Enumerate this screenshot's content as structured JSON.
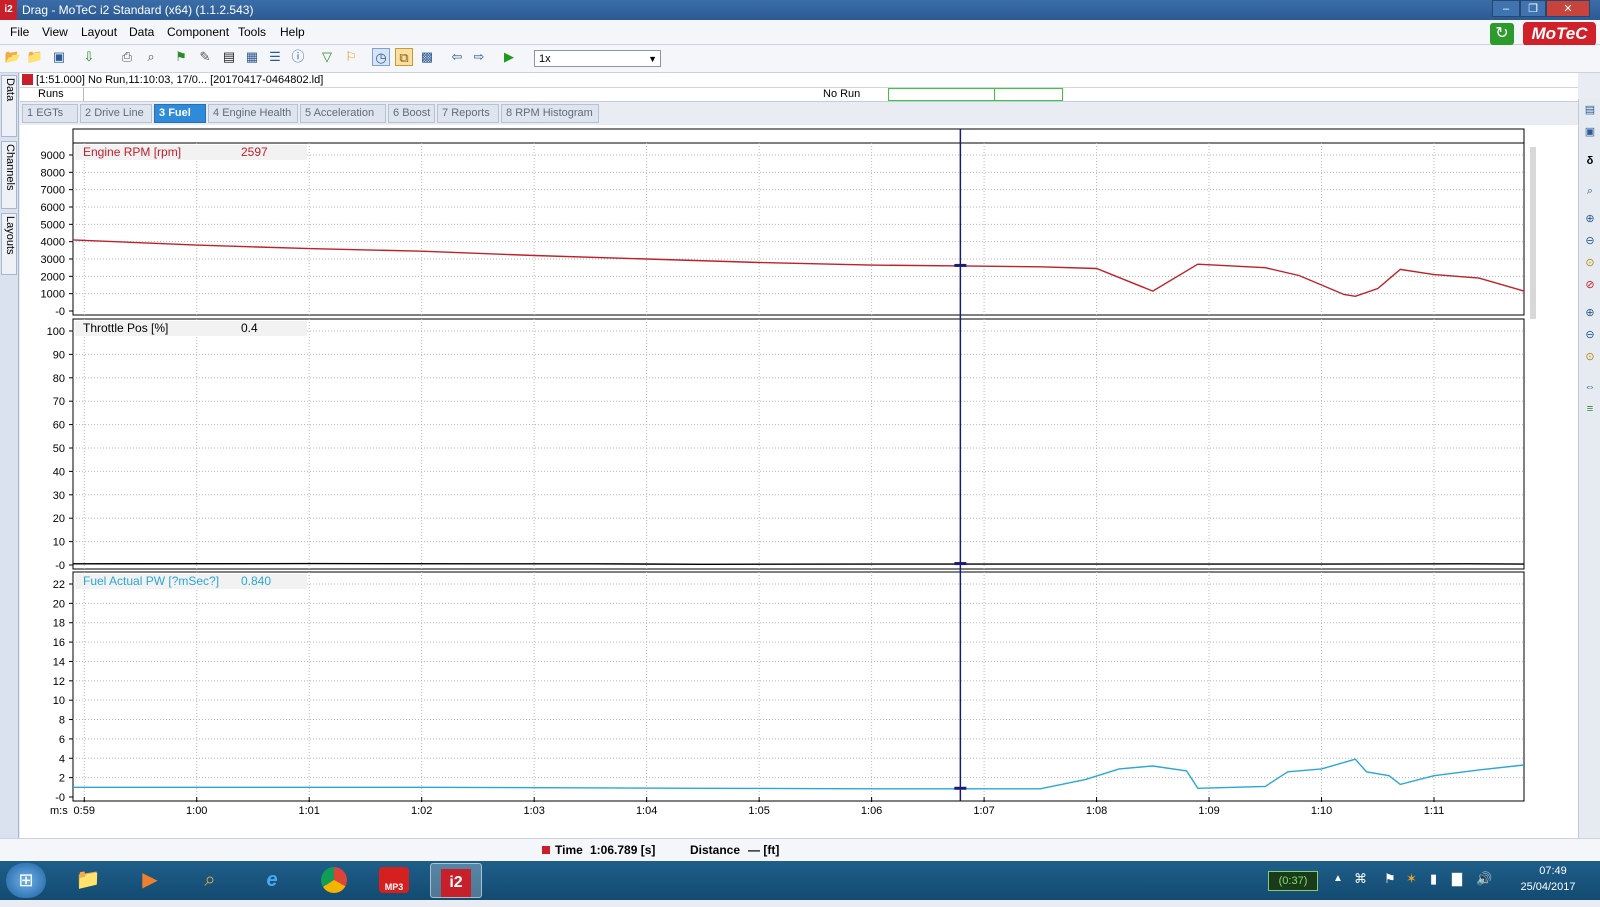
{
  "window": {
    "app_icon": "i2",
    "title": "Drag - MoTeC i2 Standard (x64) (1.1.2.543)",
    "min_icon": "minimize-icon",
    "max_icon": "maximize-icon",
    "close_icon": "close-icon"
  },
  "menu": [
    "File",
    "View",
    "Layout",
    "Data",
    "Component",
    "Tools",
    "Help"
  ],
  "brand": {
    "logo": "MoTeC",
    "color": "#d0202a"
  },
  "toolbar": {
    "icons": [
      "open-folder-icon",
      "open-icon",
      "save-icon",
      "download-icon",
      "print-icon",
      "print-preview-icon",
      "marker-icon",
      "edit-icon",
      "film-icon",
      "table-icon",
      "list-icon",
      "info-icon",
      "filter-icon",
      "flag-icon",
      "clock-icon",
      "overlay-icon",
      "grid-icon",
      "step-back-icon",
      "step-forward-icon",
      "play-icon"
    ],
    "speed_value": "1x"
  },
  "side_tabs": [
    "Data",
    "Channels",
    "Layouts"
  ],
  "info": {
    "log_line": "[1:51.000] No Run,11:10:03, 17/0...  [20170417-0464802.ld]",
    "runs_label": "Runs",
    "run_name": "No Run"
  },
  "tabs": [
    {
      "num": "1",
      "label": "EGTs",
      "active": false
    },
    {
      "num": "2",
      "label": "Drive Line",
      "active": false
    },
    {
      "num": "3",
      "label": "Fuel",
      "active": true
    },
    {
      "num": "4",
      "label": "Engine Health",
      "active": false
    },
    {
      "num": "5",
      "label": "Acceleration",
      "active": false
    },
    {
      "num": "6",
      "label": "Boost",
      "active": false
    },
    {
      "num": "7",
      "label": "Reports",
      "active": false
    },
    {
      "num": "8",
      "label": "RPM Histogram",
      "active": false
    }
  ],
  "chart_data": {
    "type": "line",
    "x_unit_label": "m:s",
    "x_ticks": [
      "0:59",
      "1:00",
      "1:01",
      "1:02",
      "1:03",
      "1:04",
      "1:05",
      "1:06",
      "1:07",
      "1:08",
      "1:09",
      "1:10",
      "1:11"
    ],
    "xlim": [
      58.9,
      71.8
    ],
    "cursor_x": 66.789,
    "panels": [
      {
        "channel": "Engine RPM [rpm]",
        "value": "2597",
        "color": "#c0202a",
        "y_ticks": [
          "9000",
          "8000",
          "7000",
          "6000",
          "5000",
          "4000",
          "3000",
          "2000",
          "1000",
          "-0"
        ],
        "ylim": [
          0,
          9000
        ],
        "x": [
          58.9,
          60.0,
          61.0,
          62.0,
          63.0,
          64.0,
          65.0,
          66.0,
          66.8,
          67.5,
          68.0,
          68.5,
          68.9,
          69.2,
          69.5,
          69.8,
          70.2,
          70.3,
          70.5,
          70.7,
          71.0,
          71.4,
          71.8
        ],
        "y": [
          4100,
          3800,
          3600,
          3450,
          3200,
          3000,
          2800,
          2650,
          2600,
          2550,
          2450,
          1150,
          2700,
          2600,
          2500,
          2050,
          950,
          850,
          1300,
          2400,
          2100,
          1900,
          1150
        ]
      },
      {
        "channel": "Throttle Pos [%]",
        "value": "0.4",
        "color": "#000000",
        "y_ticks": [
          "100",
          "90",
          "80",
          "70",
          "60",
          "50",
          "40",
          "30",
          "20",
          "10",
          "-0"
        ],
        "ylim": [
          0,
          100
        ],
        "x": [
          58.9,
          61.0,
          62.5,
          63.5,
          64.5,
          66.0,
          70.0,
          71.3,
          71.8
        ],
        "y": [
          0.5,
          0.6,
          0.5,
          0.5,
          0.3,
          0.4,
          0.4,
          0.5,
          0.4
        ]
      },
      {
        "channel": "Fuel Actual PW [?mSec?]",
        "value": "0.840",
        "color": "#2aa7d6",
        "y_ticks": [
          "22",
          "20",
          "18",
          "16",
          "14",
          "12",
          "10",
          "8",
          "6",
          "4",
          "2",
          "-0"
        ],
        "ylim": [
          0,
          22
        ],
        "x": [
          58.9,
          62.0,
          64.5,
          66.0,
          67.5,
          67.9,
          68.2,
          68.5,
          68.8,
          68.9,
          69.5,
          69.7,
          70.0,
          70.3,
          70.4,
          70.6,
          70.7,
          71.0,
          71.4,
          71.8
        ],
        "y": [
          1.0,
          1.0,
          0.9,
          0.85,
          0.85,
          1.8,
          2.9,
          3.2,
          2.7,
          0.9,
          1.1,
          2.6,
          2.9,
          3.9,
          2.6,
          2.2,
          1.3,
          2.2,
          2.8,
          3.3
        ]
      }
    ]
  },
  "status": {
    "time_label": "Time",
    "time_value": "1:06.789 [s]",
    "distance_label": "Distance",
    "distance_value": "— [ft]"
  },
  "taskbar": {
    "apps": [
      "explorer-icon",
      "media-player-icon",
      "search-app-icon",
      "internet-explorer-icon",
      "chrome-icon",
      "mp3-icon",
      "motec-i2-icon"
    ],
    "mp3_text": "MP3",
    "i2_text": "i2",
    "battery_text": "(0:37)",
    "clock_time": "07:49",
    "clock_date": "25/04/2017"
  }
}
